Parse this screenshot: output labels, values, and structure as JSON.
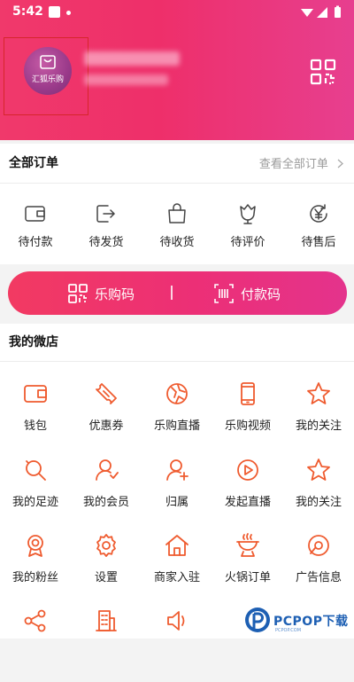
{
  "status_bar": {
    "time": "5:42"
  },
  "header": {
    "avatar_text": "汇狐乐购",
    "colors": {
      "gradient_start": "#f0396b",
      "gradient_end": "#e73f8f"
    }
  },
  "orders": {
    "title": "全部订单",
    "see_all": "查看全部订单",
    "items": [
      {
        "label": "待付款",
        "icon": "wallet-icon"
      },
      {
        "label": "待发货",
        "icon": "shipping-exit-icon"
      },
      {
        "label": "待收货",
        "icon": "shopping-bag-icon"
      },
      {
        "label": "待评价",
        "icon": "tulip-icon"
      },
      {
        "label": "待售后",
        "icon": "yen-refund-icon"
      }
    ]
  },
  "pay_bar": {
    "left_label": "乐购码",
    "sep": "|",
    "right_label": "付款码",
    "left_icon": "qr-grid-icon",
    "right_icon": "barcode-icon"
  },
  "shop": {
    "title": "我的微店",
    "items": [
      {
        "label": "钱包",
        "icon": "wallet-icon"
      },
      {
        "label": "优惠券",
        "icon": "ticket-icon"
      },
      {
        "label": "乐购直播",
        "icon": "globe-broadcast-icon"
      },
      {
        "label": "乐购视频",
        "icon": "phone-icon"
      },
      {
        "label": "我的关注",
        "icon": "star-icon"
      },
      {
        "label": "我的足迹",
        "icon": "footprint-search-icon"
      },
      {
        "label": "我的会员",
        "icon": "member-icon"
      },
      {
        "label": "归属",
        "icon": "user-add-icon"
      },
      {
        "label": "发起直播",
        "icon": "play-circle-icon"
      },
      {
        "label": "我的关注",
        "icon": "star-icon"
      },
      {
        "label": "我的粉丝",
        "icon": "medal-icon"
      },
      {
        "label": "设置",
        "icon": "gear-icon"
      },
      {
        "label": "商家入驻",
        "icon": "home-icon"
      },
      {
        "label": "火锅订单",
        "icon": "hotpot-icon"
      },
      {
        "label": "广告信息",
        "icon": "badge-icon"
      },
      {
        "icon": "share-icon"
      },
      {
        "icon": "building-icon"
      },
      {
        "icon": "speaker-icon"
      }
    ]
  },
  "watermark": {
    "text": "PCPOP下载",
    "sub": "PCPOP.COM"
  }
}
